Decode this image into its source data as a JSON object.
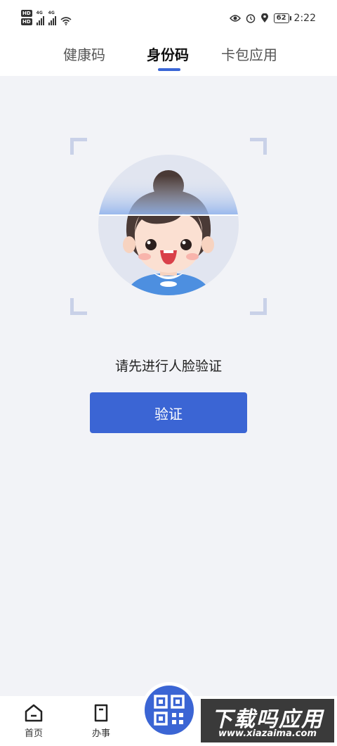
{
  "status_bar": {
    "hd1": "HD",
    "hd2": "HD",
    "net1": "4G",
    "net2": "4G",
    "battery": "62",
    "time": "2:22"
  },
  "tabs": [
    {
      "label": "健康码",
      "active": false
    },
    {
      "label": "身份码",
      "active": true
    },
    {
      "label": "卡包应用",
      "active": false
    }
  ],
  "main": {
    "prompt": "请先进行人脸验证",
    "verify_button": "验证"
  },
  "bottom_nav": {
    "home": "首页",
    "tasks": "办事"
  },
  "watermark": {
    "title": "下载吗应用",
    "url": "www.xiazaima.com"
  },
  "colors": {
    "accent": "#3b65d4",
    "background": "#f2f3f7"
  }
}
